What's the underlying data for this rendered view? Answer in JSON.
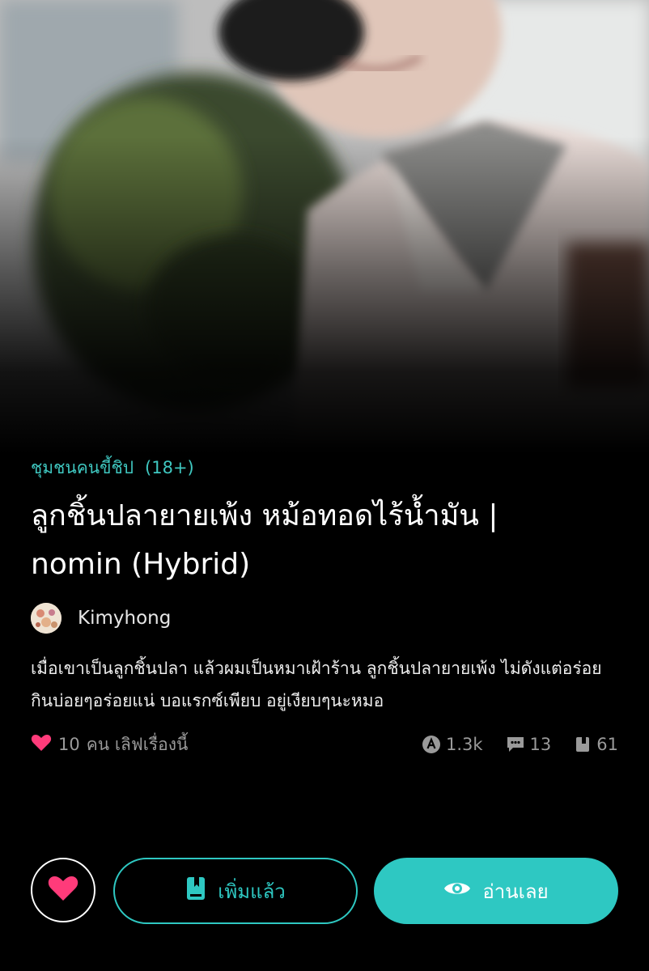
{
  "cover": {
    "icon": "story-cover-image"
  },
  "story": {
    "category": "ชุมชนคนขี้ชิป",
    "rating": "(18+)",
    "title": "ลูกชิ้นปลายายเพ้ง หม้อทอดไร้น้ำมัน | nomin (Hybrid)",
    "author": "Kimyhong",
    "description": "เมื่อเขาเป็นลูกชิ้นปลา แล้วผมเป็นหมาเฝ้าร้าน ลูกชิ้นปลายายเพ้ง ไม่ดังแต่อร่อย กินบ่อยๆอร่อยแน่ บอแรกซ์เพียบ อยู่เงียบๆนะหมอ"
  },
  "stats": {
    "love_count": "10",
    "love_text": "คน เลิฟเรื่องนี้",
    "views": "1.3k",
    "comments": "13",
    "chapters": "61"
  },
  "actions": {
    "added_label": "เพิ่มแล้ว",
    "read_label": "อ่านเลย"
  },
  "colors": {
    "accent": "#2ec8c2",
    "heart": "#ff3b7a",
    "category": "#3fc7c0"
  }
}
